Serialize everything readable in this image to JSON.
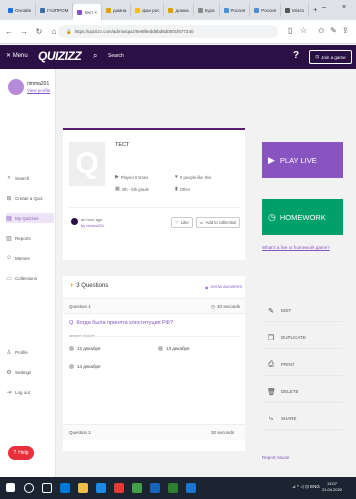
{
  "browser": {
    "tabs": [
      {
        "label": "Онлайн"
      },
      {
        "label": "ГАЗПРОМ"
      },
      {
        "label": "тест ×",
        "active": true
      },
      {
        "label": "домна"
      },
      {
        "label": "фан рос"
      },
      {
        "label": "домна"
      },
      {
        "label": "Кура"
      },
      {
        "label": "Россия"
      },
      {
        "label": "Россия"
      },
      {
        "label": "Mi441"
      }
    ],
    "new_tab": "+",
    "url": "https://quizizz.com/admin/quiz/5e8f8edd5bd6d0001f677340",
    "window_controls": [
      "–",
      "×"
    ]
  },
  "header": {
    "menu_label": "✕ Menu",
    "logo": "QUIZIZZ",
    "search_label": "Search",
    "help_glyph": "?",
    "join_label": "Join a game"
  },
  "sidebar": {
    "user_name": "rimma201",
    "profile_link": "View profile",
    "items": [
      {
        "label": "Search",
        "icon": "⌕"
      },
      {
        "label": "Create a Quiz",
        "icon": "⊞"
      },
      {
        "label": "My Quizzes",
        "icon": "▤",
        "active": true
      },
      {
        "label": "Reports",
        "icon": "▥"
      },
      {
        "label": "Memes",
        "icon": "☺"
      },
      {
        "label": "Collections",
        "icon": "▭"
      },
      {
        "label": "Profile",
        "icon": "♙"
      },
      {
        "label": "Settings",
        "icon": "⚙"
      },
      {
        "label": "Log out",
        "icon": "⇥"
      }
    ],
    "help_label": "Help"
  },
  "quiz": {
    "title": "ТЕСТ",
    "played": "Played 0 times",
    "likes": "0 people like this",
    "grade": "4th - 5th grade",
    "subject": "Other",
    "created_time": "an hour ago",
    "created_by": "by rimma201",
    "like_label": "Like",
    "add_collection_label": "Add to collection"
  },
  "actions": {
    "play_live": "PLAY LIVE",
    "homework": "HOMEWORK",
    "what_link": "What's a live or homework game?",
    "items": [
      {
        "label": "EDIT",
        "icon": "✎"
      },
      {
        "label": "DUPLICATE",
        "icon": "❐"
      },
      {
        "label": "PRINT",
        "icon": "⎙"
      },
      {
        "label": "DELETE",
        "icon": "🗑"
      },
      {
        "label": "SHARE",
        "icon": "⤷"
      }
    ],
    "report_abuse": "Report Abuse"
  },
  "questions": {
    "count_label": "3 Questions",
    "show_answers": "SHOW ANSWERS",
    "q1": {
      "num": "Question 1",
      "time": "40 seconds",
      "text": "Q. Когда была принята конституция РФ?",
      "answer_label": "answer choices",
      "choices": [
        "12 декабря",
        "13 декабря",
        "14 декабря"
      ]
    },
    "q2": {
      "num": "Question 2",
      "time": "30 seconds"
    }
  },
  "taskbar": {
    "time": "13:07",
    "date": "21.04.2020",
    "tray": "⊿ ^ ◁ ⊡ ENG"
  },
  "colors": {
    "brand": "#2a1045",
    "accent": "#8854c0",
    "homework": "#00a06a",
    "help": "#e8303c"
  }
}
